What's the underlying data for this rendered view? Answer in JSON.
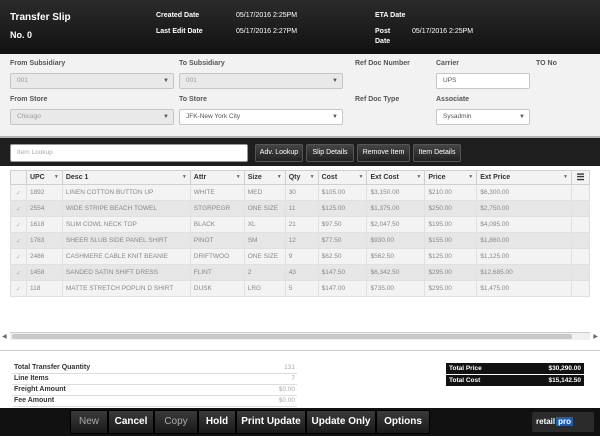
{
  "header": {
    "title": "Transfer Slip",
    "number": "No. 0",
    "created_label": "Created Date",
    "created_value": "05/17/2016 2:25PM",
    "last_edit_label": "Last Edit Date",
    "last_edit_value": "05/17/2016 2:27PM",
    "eta_label": "ETA Date",
    "eta_value": "",
    "post_label_1": "Post",
    "post_label_2": "Date",
    "post_value": "05/17/2016 2:25PM"
  },
  "form": {
    "from_subsidiary_label": "From Subsidiary",
    "from_subsidiary_value": "001",
    "to_subsidiary_label": "To Subsidiary",
    "to_subsidiary_value": "001",
    "ref_doc_number_label": "Ref Doc Number",
    "carrier_label": "Carrier",
    "carrier_value": "UPS",
    "to_no_label": "TO No",
    "from_store_label": "From Store",
    "from_store_value": "Chicago",
    "to_store_label": "To Store",
    "to_store_value": "JFK-New York City",
    "ref_doc_type_label": "Ref Doc Type",
    "associate_label": "Associate",
    "associate_value": "Sysadmin"
  },
  "toolbar": {
    "lookup_placeholder": "Item Lookup",
    "adv_lookup": "Adv. Lookup",
    "slip_details": "Slip Details",
    "remove_item": "Remove Item",
    "item_details": "Item Details"
  },
  "grid": {
    "columns": [
      "UPC",
      "Desc 1",
      "Attr",
      "Size",
      "Qty",
      "Cost",
      "Ext Cost",
      "Price",
      "Ext Price"
    ],
    "rows": [
      [
        "1892",
        "LINEN COTTON BUTTON UP",
        "WHITE",
        "MED",
        "30",
        "$105.00",
        "$3,150.00",
        "$210.00",
        "$6,300.00"
      ],
      [
        "2554",
        "WIDE STRIPE BEACH TOWEL",
        "STGRPEGR",
        "ONE SIZE",
        "11",
        "$125.00",
        "$1,375.00",
        "$250.00",
        "$2,750.00"
      ],
      [
        "1618",
        "SLIM COWL NECK TOP",
        "BLACK",
        "XL",
        "21",
        "$97.50",
        "$2,047.50",
        "$195.00",
        "$4,095.00"
      ],
      [
        "1783",
        "SHEER SLUB SIDE PANEL SHIRT",
        "PINOT",
        "SM",
        "12",
        "$77.50",
        "$930.00",
        "$155.00",
        "$1,860.00"
      ],
      [
        "2486",
        "CASHMERE CABLE KNIT BEANIE",
        "DRIFTWOO",
        "ONE SIZE",
        "9",
        "$62.50",
        "$562.50",
        "$125.00",
        "$1,125.00"
      ],
      [
        "1458",
        "SANDED SATIN SHIFT DRESS",
        "FLINT",
        "2",
        "43",
        "$147.50",
        "$6,342.50",
        "$295.00",
        "$12,685.00"
      ],
      [
        "118",
        "MATTE STRETCH POPLIN D SHIRT",
        "DUSK",
        "LRG",
        "5",
        "$147.00",
        "$735.00",
        "$295.00",
        "$1,475.00"
      ]
    ]
  },
  "summary": {
    "total_transfer_qty_label": "Total Transfer Quantity",
    "total_transfer_qty_value": "131",
    "line_items_label": "Line Items",
    "line_items_value": "7",
    "freight_label": "Freight Amount",
    "freight_value": "$0.00",
    "fee_label": "Fee Amount",
    "fee_value": "$0.00",
    "total_price_label": "Total Price",
    "total_price_value": "$30,290.00",
    "total_cost_label": "Total Cost",
    "total_cost_value": "$15,142.50"
  },
  "bottom_bar": {
    "new": "New",
    "cancel": "Cancel",
    "copy": "Copy",
    "hold": "Hold",
    "print_update": "Print Update",
    "update_only": "Update Only",
    "options": "Options",
    "logo_a": "retail",
    "logo_b": "pro"
  }
}
